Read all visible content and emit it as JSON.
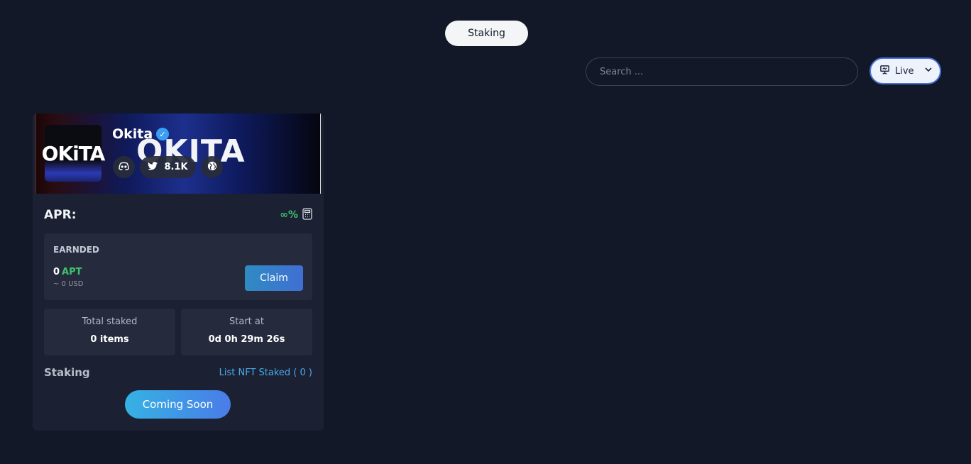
{
  "nav": {
    "tab_label": "Staking"
  },
  "search": {
    "placeholder": "Search ..."
  },
  "filter": {
    "selected": "Live",
    "icon": "presentation-icon",
    "chevron": "chevron-down-icon"
  },
  "card": {
    "banner_text": "OKITA",
    "logo_text": "OKiTA",
    "name": "Okita",
    "verified_icon": "verified-check-icon",
    "socials": {
      "discord_icon": "discord-icon",
      "twitter_icon": "twitter-icon",
      "twitter_followers": "8.1K",
      "website_icon": "globe-icon"
    },
    "apr_label": "APR:",
    "apr_value": "∞%",
    "calculator_icon": "calculator-icon",
    "earned": {
      "title": "EARNDED",
      "amount": "0",
      "token": "APT",
      "usd": "~ 0 USD",
      "claim_label": "Claim"
    },
    "stats": {
      "total_staked_label": "Total staked",
      "total_staked_value": "0 items",
      "start_at_label": "Start at",
      "start_at_value": "0d 0h 29m 26s"
    },
    "staking_label": "Staking",
    "list_link": "List NFT Staked ( 0 )",
    "action_label": "Coming Soon"
  },
  "colors": {
    "background": "#131829",
    "card": "#1b2133",
    "panel": "#252b3c",
    "green": "#3fc26a",
    "link": "#4aa8e8",
    "accent": "#3f6fd3"
  }
}
